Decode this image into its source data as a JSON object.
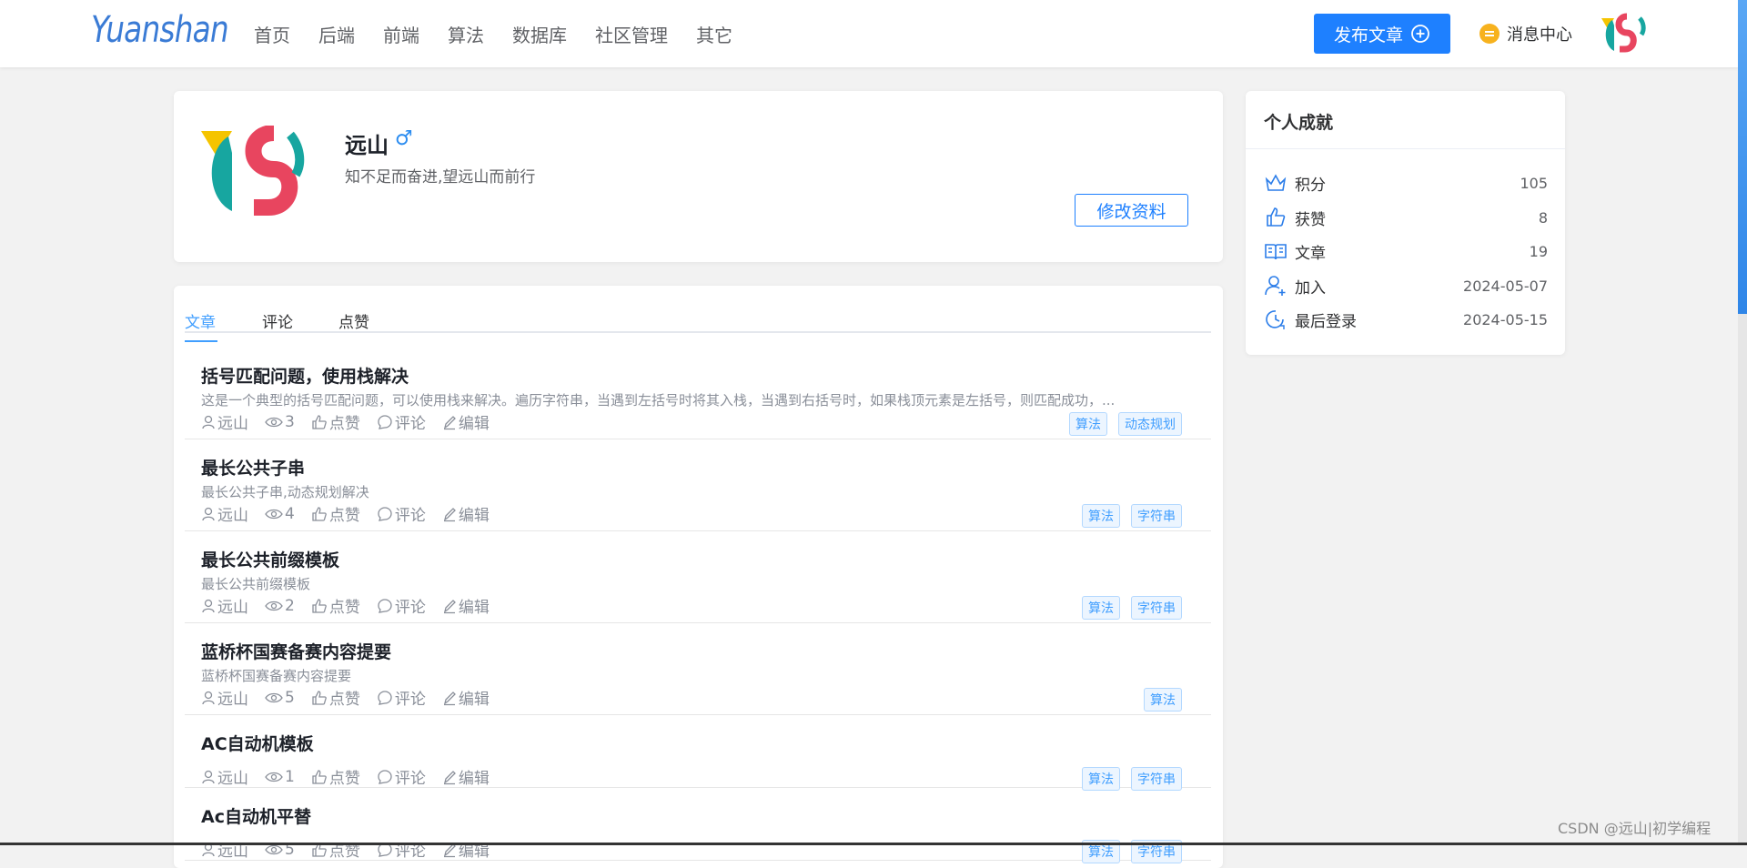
{
  "brand": {
    "logo": "Yuanshan"
  },
  "nav": [
    "首页",
    "后端",
    "前端",
    "算法",
    "数据库",
    "社区管理",
    "其它"
  ],
  "header": {
    "publish_label": "发布文章",
    "messages_label": "消息中心"
  },
  "profile": {
    "name": "远山",
    "gender_symbol": "♂",
    "bio": "知不足而奋进,望远山而前行",
    "edit_label": "修改资料"
  },
  "achievements": {
    "title": "个人成就",
    "items": [
      {
        "icon": "crown-icon",
        "label": "积分",
        "value": "105"
      },
      {
        "icon": "thumbs-up-icon",
        "label": "获赞",
        "value": "8"
      },
      {
        "icon": "book-icon",
        "label": "文章",
        "value": "19"
      },
      {
        "icon": "user-add-icon",
        "label": "加入",
        "value": "2024-05-07"
      },
      {
        "icon": "clock-icon",
        "label": "最后登录",
        "value": "2024-05-15"
      }
    ]
  },
  "tabs": [
    "文章",
    "评论",
    "点赞"
  ],
  "articles": [
    {
      "title": "括号匹配问题，使用栈解决",
      "summary": "这是一个典型的括号匹配问题，可以使用栈来解决。遍历字符串，当遇到左括号时将其入栈，当遇到右括号时，如果栈顶元素是左括号，则匹配成功，...",
      "author": "远山",
      "views": "3",
      "like": "点赞",
      "comment": "评论",
      "edit": "编辑",
      "tags": [
        "算法",
        "动态规划"
      ]
    },
    {
      "title": "最长公共子串",
      "summary": "最长公共子串,动态规划解决",
      "author": "远山",
      "views": "4",
      "like": "点赞",
      "comment": "评论",
      "edit": "编辑",
      "tags": [
        "算法",
        "字符串"
      ]
    },
    {
      "title": "最长公共前缀模板",
      "summary": "最长公共前缀模板",
      "author": "远山",
      "views": "2",
      "like": "点赞",
      "comment": "评论",
      "edit": "编辑",
      "tags": [
        "算法",
        "字符串"
      ]
    },
    {
      "title": "蓝桥杯国赛备赛内容提要",
      "summary": "蓝桥杯国赛备赛内容提要",
      "author": "远山",
      "views": "5",
      "like": "点赞",
      "comment": "评论",
      "edit": "编辑",
      "tags": [
        "算法"
      ]
    },
    {
      "title": "AC自动机模板",
      "summary": "",
      "author": "远山",
      "views": "1",
      "like": "点赞",
      "comment": "评论",
      "edit": "编辑",
      "tags": [
        "算法",
        "字符串"
      ]
    },
    {
      "title": "Ac自动机平替",
      "summary": "",
      "author": "远山",
      "views": "5",
      "like": "点赞",
      "comment": "评论",
      "edit": "编辑",
      "tags": [
        "算法",
        "字符串"
      ]
    }
  ],
  "watermark": "CSDN @远山|初学编程",
  "colors": {
    "accent": "#1e80ff",
    "link": "#409eff",
    "bubble": "#f7b21e"
  }
}
